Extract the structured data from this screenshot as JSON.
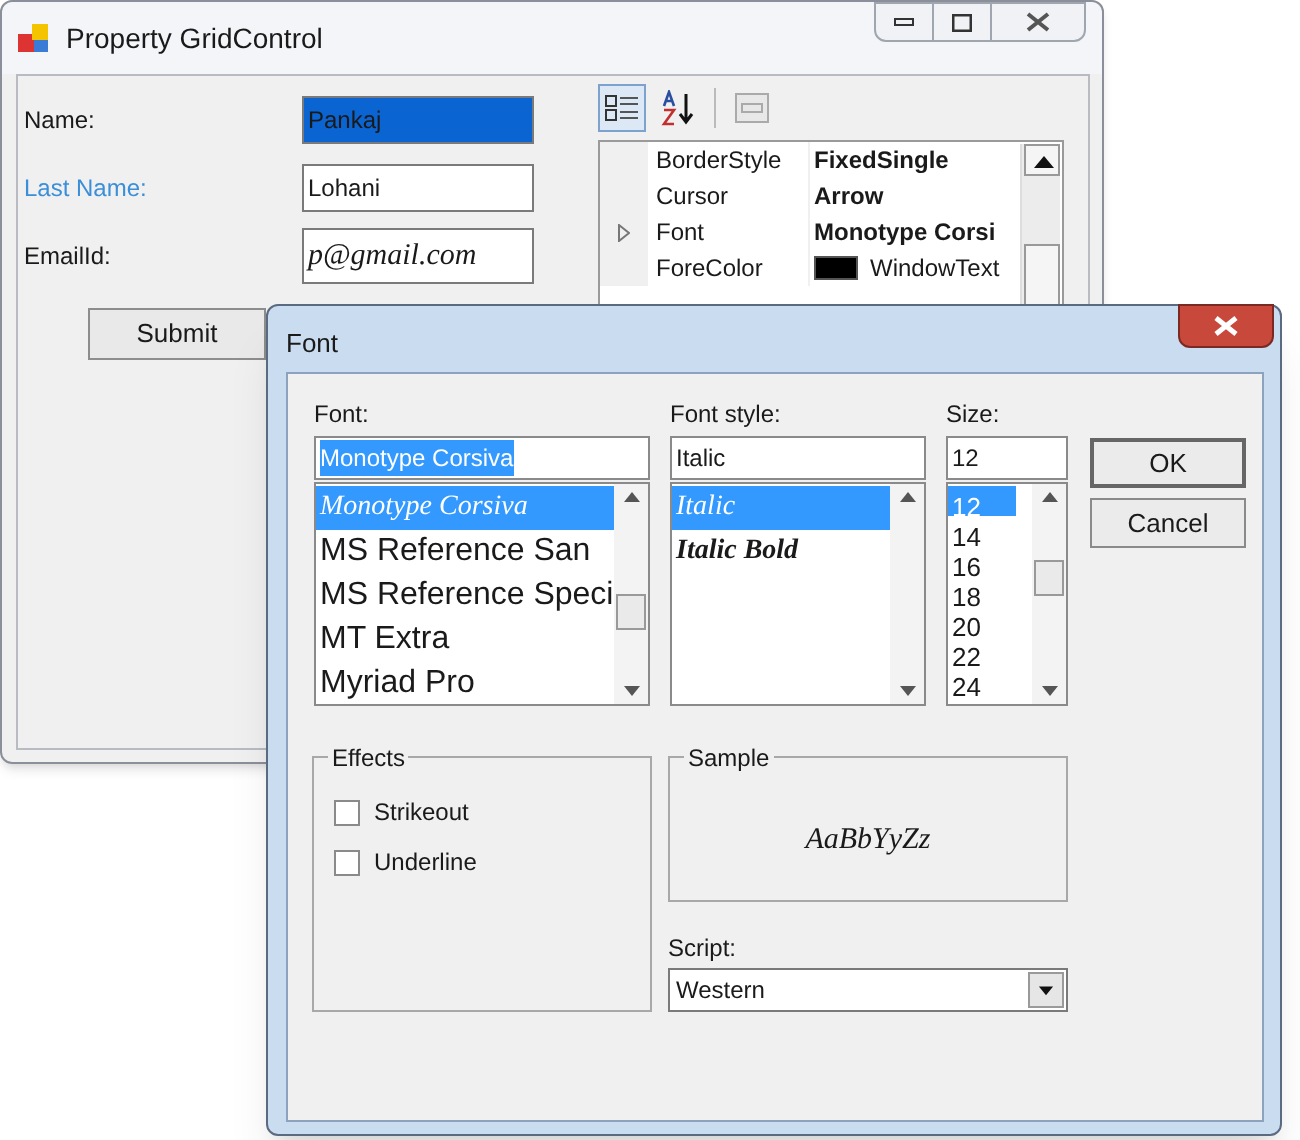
{
  "main_window": {
    "title": "Property GridControl",
    "fields": [
      {
        "label": "Name:",
        "value": "Pankaj",
        "kind": "plain",
        "highlighted": true,
        "color": "#1a1a1a"
      },
      {
        "label": "Last Name:",
        "value": "Lohani",
        "kind": "plain",
        "highlighted": false,
        "color": "#3b8fd9"
      },
      {
        "label": "EmailId:",
        "value": "p@gmail.com",
        "kind": "script",
        "highlighted": false,
        "color": "#1a1a1a"
      }
    ],
    "submit": "Submit",
    "property_grid": {
      "toolbar": [
        {
          "kind": "categorized",
          "selected": true
        },
        {
          "kind": "alphabetical",
          "selected": false
        },
        {
          "kind": "pages",
          "selected": false
        }
      ],
      "rows": [
        {
          "name": "BorderStyle",
          "value": "FixedSingle",
          "kind": "text",
          "expandable": false
        },
        {
          "name": "Cursor",
          "value": "Arrow",
          "kind": "text",
          "expandable": false
        },
        {
          "name": "Font",
          "value": "Monotype Corsi",
          "kind": "text",
          "expandable": true
        },
        {
          "name": "ForeColor",
          "value": "WindowText",
          "kind": "color",
          "color": "#000000",
          "expandable": false
        }
      ]
    }
  },
  "font_dialog": {
    "title": "Font",
    "font": {
      "label": "Font:",
      "value": "Monotype Corsiva",
      "items": [
        {
          "text": "Monotype Corsiva",
          "kind": "script",
          "selected": true
        },
        {
          "text": "MS Reference San",
          "kind": "large",
          "selected": false
        },
        {
          "text": "MS Reference Speci",
          "kind": "large",
          "selected": false
        },
        {
          "text": "MT Extra",
          "kind": "large",
          "selected": false
        },
        {
          "text": "Myriad Pro",
          "kind": "large",
          "selected": false
        }
      ]
    },
    "style": {
      "label": "Font style:",
      "value": "Italic",
      "items": [
        {
          "text": "Italic",
          "kind": "italic",
          "selected": true
        },
        {
          "text": "Italic Bold",
          "kind": "bold_italic",
          "selected": false
        }
      ]
    },
    "size": {
      "label": "Size:",
      "value": "12",
      "items": [
        {
          "text": "12",
          "kind": "plain",
          "selected": true
        },
        {
          "text": "14",
          "kind": "plain",
          "selected": false
        },
        {
          "text": "16",
          "kind": "plain",
          "selected": false
        },
        {
          "text": "18",
          "kind": "plain",
          "selected": false
        },
        {
          "text": "20",
          "kind": "plain",
          "selected": false
        },
        {
          "text": "22",
          "kind": "plain",
          "selected": false
        },
        {
          "text": "24",
          "kind": "plain",
          "selected": false
        }
      ]
    },
    "buttons": [
      "OK",
      "Cancel"
    ],
    "effects": {
      "title": "Effects",
      "options": [
        {
          "label": "Strikeout",
          "checked": false
        },
        {
          "label": "Underline",
          "checked": false
        }
      ]
    },
    "sample": {
      "title": "Sample",
      "text": "AaBbYyZz"
    },
    "script": {
      "label": "Script:",
      "value": "Western"
    }
  }
}
